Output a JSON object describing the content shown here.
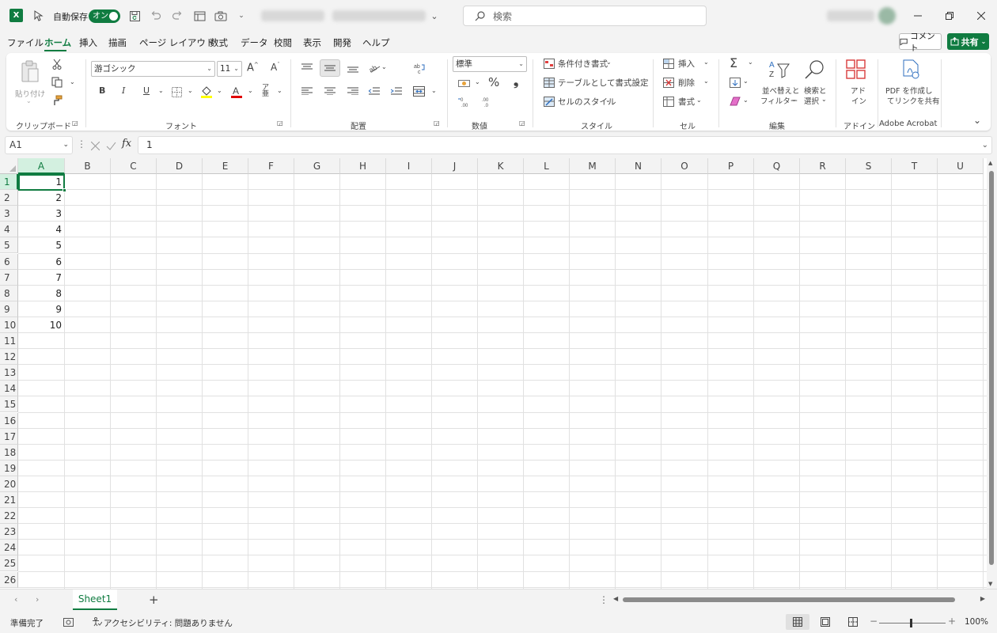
{
  "titlebar": {
    "autosave_label": "自動保存",
    "autosave_state": "オン",
    "search_placeholder": "検索"
  },
  "menu": {
    "items": [
      "ファイル",
      "ホーム",
      "挿入",
      "描画",
      "ページ レイアウト",
      "数式",
      "データ",
      "校閲",
      "表示",
      "開発",
      "ヘルプ"
    ],
    "active": "ホーム",
    "comment_label": "コメント",
    "share_label": "共有"
  },
  "ribbon": {
    "clipboard": {
      "paste": "貼り付け",
      "label": "クリップボード"
    },
    "font": {
      "font_name": "游ゴシック",
      "font_size": "11",
      "label": "フォント",
      "bold": "B",
      "italic": "I",
      "underline": "U",
      "grow": "A^",
      "shrink": "Aˇ"
    },
    "alignment": {
      "label": "配置"
    },
    "number": {
      "format": "標準",
      "percent": "%",
      "comma": "❟",
      "label": "数値"
    },
    "styles": {
      "conditional": "条件付き書式",
      "table": "テーブルとして書式設定",
      "cell_styles": "セルのスタイル",
      "label": "スタイル"
    },
    "cells": {
      "insert": "挿入",
      "delete": "削除",
      "format": "書式",
      "label": "セル"
    },
    "editing": {
      "sort_filter_1": "並べ替えと",
      "sort_filter_2": "フィルター",
      "find_1": "検索と",
      "find_2": "選択",
      "label": "編集"
    },
    "addins": {
      "addin_1": "アド",
      "addin_2": "イン",
      "label": "アドイン"
    },
    "acrobat": {
      "pdf_1": "PDF を作成し",
      "pdf_2": "てリンクを共有",
      "label": "Adobe Acrobat"
    }
  },
  "formula_bar": {
    "name_box": "A1",
    "fx": "fx",
    "content": "1"
  },
  "grid": {
    "columns": [
      "A",
      "B",
      "C",
      "D",
      "E",
      "F",
      "G",
      "H",
      "I",
      "J",
      "K",
      "L",
      "M",
      "N",
      "O",
      "P",
      "Q",
      "R",
      "S",
      "T",
      "U"
    ],
    "rows": [
      "1",
      "2",
      "3",
      "4",
      "5",
      "6",
      "7",
      "8",
      "9",
      "10",
      "11",
      "12",
      "13",
      "14",
      "15",
      "16",
      "17",
      "18",
      "19",
      "20",
      "21",
      "22",
      "23",
      "24",
      "25",
      "26"
    ],
    "column_a_values": [
      "1",
      "2",
      "3",
      "4",
      "5",
      "6",
      "7",
      "8",
      "9",
      "10"
    ],
    "selected_cell": "A1"
  },
  "sheets": {
    "tabs": [
      "Sheet1"
    ],
    "active": "Sheet1",
    "add": "+"
  },
  "status": {
    "ready": "準備完了",
    "accessibility": "アクセシビリティ: 問題ありません",
    "zoom": "100%"
  },
  "colors": {
    "accent": "#107c41",
    "selected_header": "#d3f0e0"
  }
}
